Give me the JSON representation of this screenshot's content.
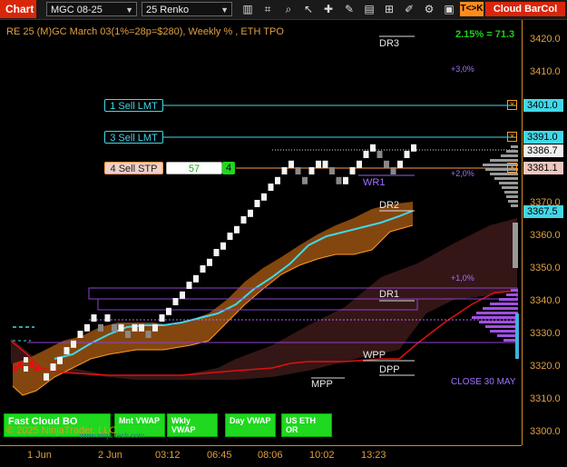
{
  "toolbar": {
    "tab_label": "Chart",
    "instrument": "MGC 08-25",
    "bar_type": "25 Renko",
    "tk_label": "T<>K",
    "cloud_label": "Cloud",
    "barcol_label": "BarCol"
  },
  "chart_title": "RE 25 (M)GC March 03(1%=28p=$280), Weekly % , ETH TPO",
  "performance": "2.15% = 71.3",
  "orders": {
    "o1": "1 Sell LMT",
    "o2": "3 Sell LMT",
    "o3": "4 Sell STP",
    "o3_qty": "57",
    "o3_count": "4"
  },
  "levels": {
    "dr3": "DR3",
    "wr1": "WR1",
    "dr2": "DR2",
    "dr1": "DR1",
    "wpp": "WPP",
    "dpp": "DPP",
    "mpp": "MPP",
    "pct3": "+3,0%",
    "pct2": "+2,0%",
    "pct1": "+1,0%",
    "close": "CLOSE 30 MAY"
  },
  "price_tags": {
    "t1": "3401.0",
    "t2": "3391.0",
    "t3": "3386.7",
    "t4": "3381.1",
    "t5": "3367.5"
  },
  "y_ticks": [
    "3420.0",
    "3410.0",
    "3400.0",
    "3390.0",
    "3380.0",
    "3370.0",
    "3360.0",
    "3350.0",
    "3340.0",
    "3330.0",
    "3320.0",
    "3310.0",
    "3300.0"
  ],
  "x_ticks": [
    "1 Jun",
    "2 Jun",
    "03:12",
    "06:45",
    "08:06",
    "10:02",
    "13:23"
  ],
  "buttons": {
    "fast_cloud": "Fast Cloud BO",
    "mnt_vwap": "Mnt VWAP",
    "wkly_vwap": "Wkly VWAP",
    "day_vwap": "Day VWAP",
    "us_eth_or": "US ETH OR"
  },
  "copyright": "© 2025 NinjaTrader, LLC",
  "watermark": "www.ninja-tech.com",
  "colors": {
    "bg": "#000000",
    "axis": "#d08a2a",
    "cloud_orange": "#8a4a10",
    "cloud_red": "#3a1818",
    "cyan": "#40d8e8",
    "red_line": "#e01010",
    "purple": "#a070ff",
    "green": "#1fd81f"
  },
  "chart_data": {
    "type": "renko",
    "ylim": [
      3296,
      3426
    ],
    "brick_size": 2.5,
    "bricks_up_top": [
      3318,
      3321,
      3323,
      3326,
      3328,
      3331,
      3333,
      3336,
      3333,
      3336,
      3333,
      3333,
      3331,
      3333,
      3333,
      3331,
      3333,
      3336,
      3338,
      3341,
      3343,
      3346,
      3348,
      3351,
      3353,
      3356,
      3358,
      3361,
      3363,
      3366,
      3368,
      3371,
      3373,
      3376,
      3378,
      3381,
      3383,
      3381,
      3378,
      3381,
      3383,
      3383,
      3381,
      3378,
      3378,
      3381,
      3383,
      3386,
      3388,
      3386,
      3383,
      3381,
      3383,
      3386,
      3388
    ]
  }
}
